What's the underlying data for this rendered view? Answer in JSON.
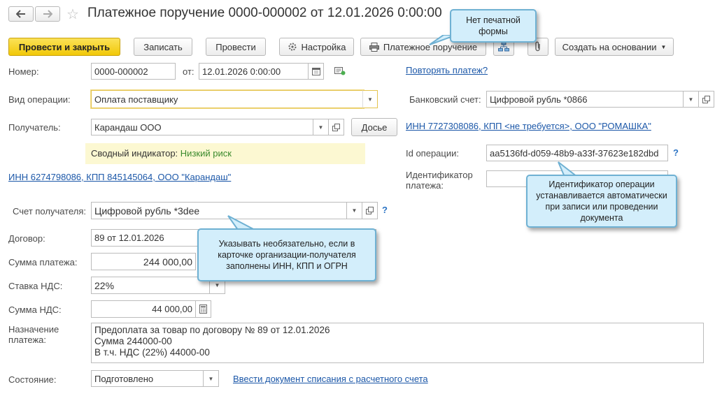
{
  "window": {
    "title": "Платежное поручение 0000-000002 от 12.01.2026 0:00:00"
  },
  "toolbar": {
    "post_close": "Провести и закрыть",
    "save": "Записать",
    "post": "Провести",
    "settings": "Настройка",
    "print": "Платежное поручение",
    "create_based": "Создать на основании"
  },
  "form": {
    "number_label": "Номер:",
    "number_value": "0000-000002",
    "date_label": "от:",
    "date_value": "12.01.2026  0:00:00",
    "repeat_link": "Повторять платеж?",
    "operation_label": "Вид операции:",
    "operation_value": "Оплата поставщику",
    "bank_account_label": "Банковский счет:",
    "bank_account_value": "Цифровой рубль *0866",
    "recipient_label": "Получатель:",
    "recipient_value": "Карандаш ООО",
    "dossier_button": "Досье",
    "own_inn_link": "ИНН 7727308086, КПП <не требуется>, ООО \"РОМАШКА\"",
    "risk_label": "Сводный индикатор:",
    "risk_value": "Низкий риск",
    "op_id_label": "Id операции:",
    "op_id_value": "aa5136fd-d059-48b9-a33f-37623e182dbd",
    "recipient_inn_link": "ИНН 6274798086, КПП 845145064, ООО \"Карандаш\"",
    "payment_id_label": "Идентификатор платежа:",
    "payment_id_value": "",
    "recipient_account_label": "Счет получателя:",
    "recipient_account_value": "Цифровой рубль *3dee",
    "contract_label": "Договор:",
    "contract_value": "89 от 12.01.2026",
    "amount_label": "Сумма платежа:",
    "amount_value": "244 000,00",
    "vat_rate_label": "Ставка НДС:",
    "vat_rate_value": "22%",
    "vat_amount_label": "Сумма НДС:",
    "vat_amount_value": "44 000,00",
    "purpose_label": "Назначение платежа:",
    "purpose_lines": [
      "Предоплата за товар по договору № 89 от 12.01.2026",
      "Сумма 244000-00",
      "В т.ч. НДС  (22%) 44000-00"
    ],
    "state_label": "Состояние:",
    "state_value": "Подготовлено",
    "writeoff_link": "Ввести документ списания с расчетного счета"
  },
  "callouts": {
    "no_print_form": "Нет печатной формы",
    "op_id_auto": "Идентификатор операции устанавливается автоматически при записи или проведении документа",
    "optional_account": "Указывать необязательно, если в карточке организации-получателя заполнены ИНН, КПП и ОГРН"
  },
  "icons": {
    "back": "arrow-left-icon",
    "forward": "arrow-right-icon",
    "favorite": "star-icon",
    "settings": "gear-icon",
    "print": "printer-icon",
    "structure": "hierarchy-icon",
    "attach": "paperclip-icon",
    "calendar": "calendar-icon",
    "open": "open-form-icon",
    "calculator": "calculator-icon",
    "help": "question-icon"
  },
  "colors": {
    "primary_button": "#f5d423",
    "link": "#1b57a8",
    "risk_text": "#3a8a2c",
    "risk_bg": "#fcf8d2",
    "callout_bg": "#d3eefb",
    "callout_border": "#6fb1d3"
  }
}
